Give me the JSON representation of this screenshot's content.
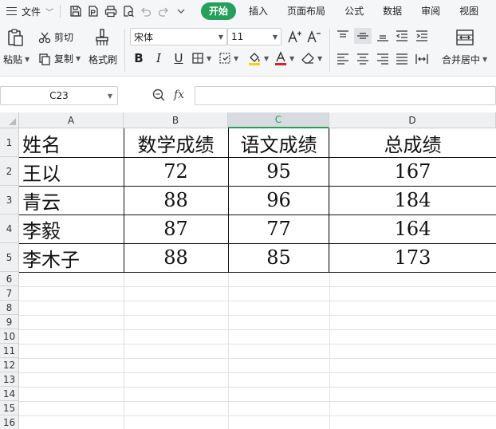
{
  "menubar": {
    "file_label": "文件",
    "tabs": [
      {
        "label": "开始",
        "active": true
      },
      {
        "label": "插入",
        "active": false
      },
      {
        "label": "页面布局",
        "active": false
      },
      {
        "label": "公式",
        "active": false
      },
      {
        "label": "数据",
        "active": false
      },
      {
        "label": "审阅",
        "active": false
      },
      {
        "label": "视图",
        "active": false
      }
    ]
  },
  "ribbon": {
    "paste_label": "粘贴",
    "cut_label": "剪切",
    "copy_label": "复制",
    "format_painter_label": "格式刷",
    "font_name": "宋体",
    "font_size": "11",
    "bold_label": "B",
    "italic_label": "I",
    "underline_label": "U",
    "merge_center_label": "合并居中"
  },
  "formula_bar": {
    "name_box": "C23",
    "fx_label": "fx",
    "formula": ""
  },
  "sheet": {
    "columns": [
      "A",
      "B",
      "C",
      "D"
    ],
    "selected_column": "C",
    "row_numbers": [
      "1",
      "2",
      "3",
      "4",
      "5",
      "6",
      "7",
      "8",
      "9",
      "10",
      "11",
      "12",
      "13",
      "14",
      "15",
      "16"
    ],
    "header": [
      "姓名",
      "数学成绩",
      "语文成绩",
      "总成绩"
    ],
    "rows": [
      [
        "王以",
        "72",
        "95",
        "167"
      ],
      [
        "青云",
        "88",
        "96",
        "184"
      ],
      [
        "李毅",
        "87",
        "77",
        "164"
      ],
      [
        "李木子",
        "88",
        "85",
        "173"
      ]
    ]
  },
  "colors": {
    "accent": "#25a05a",
    "chrome_bg": "#f5f6f7",
    "header_bg": "#eef0f2"
  }
}
